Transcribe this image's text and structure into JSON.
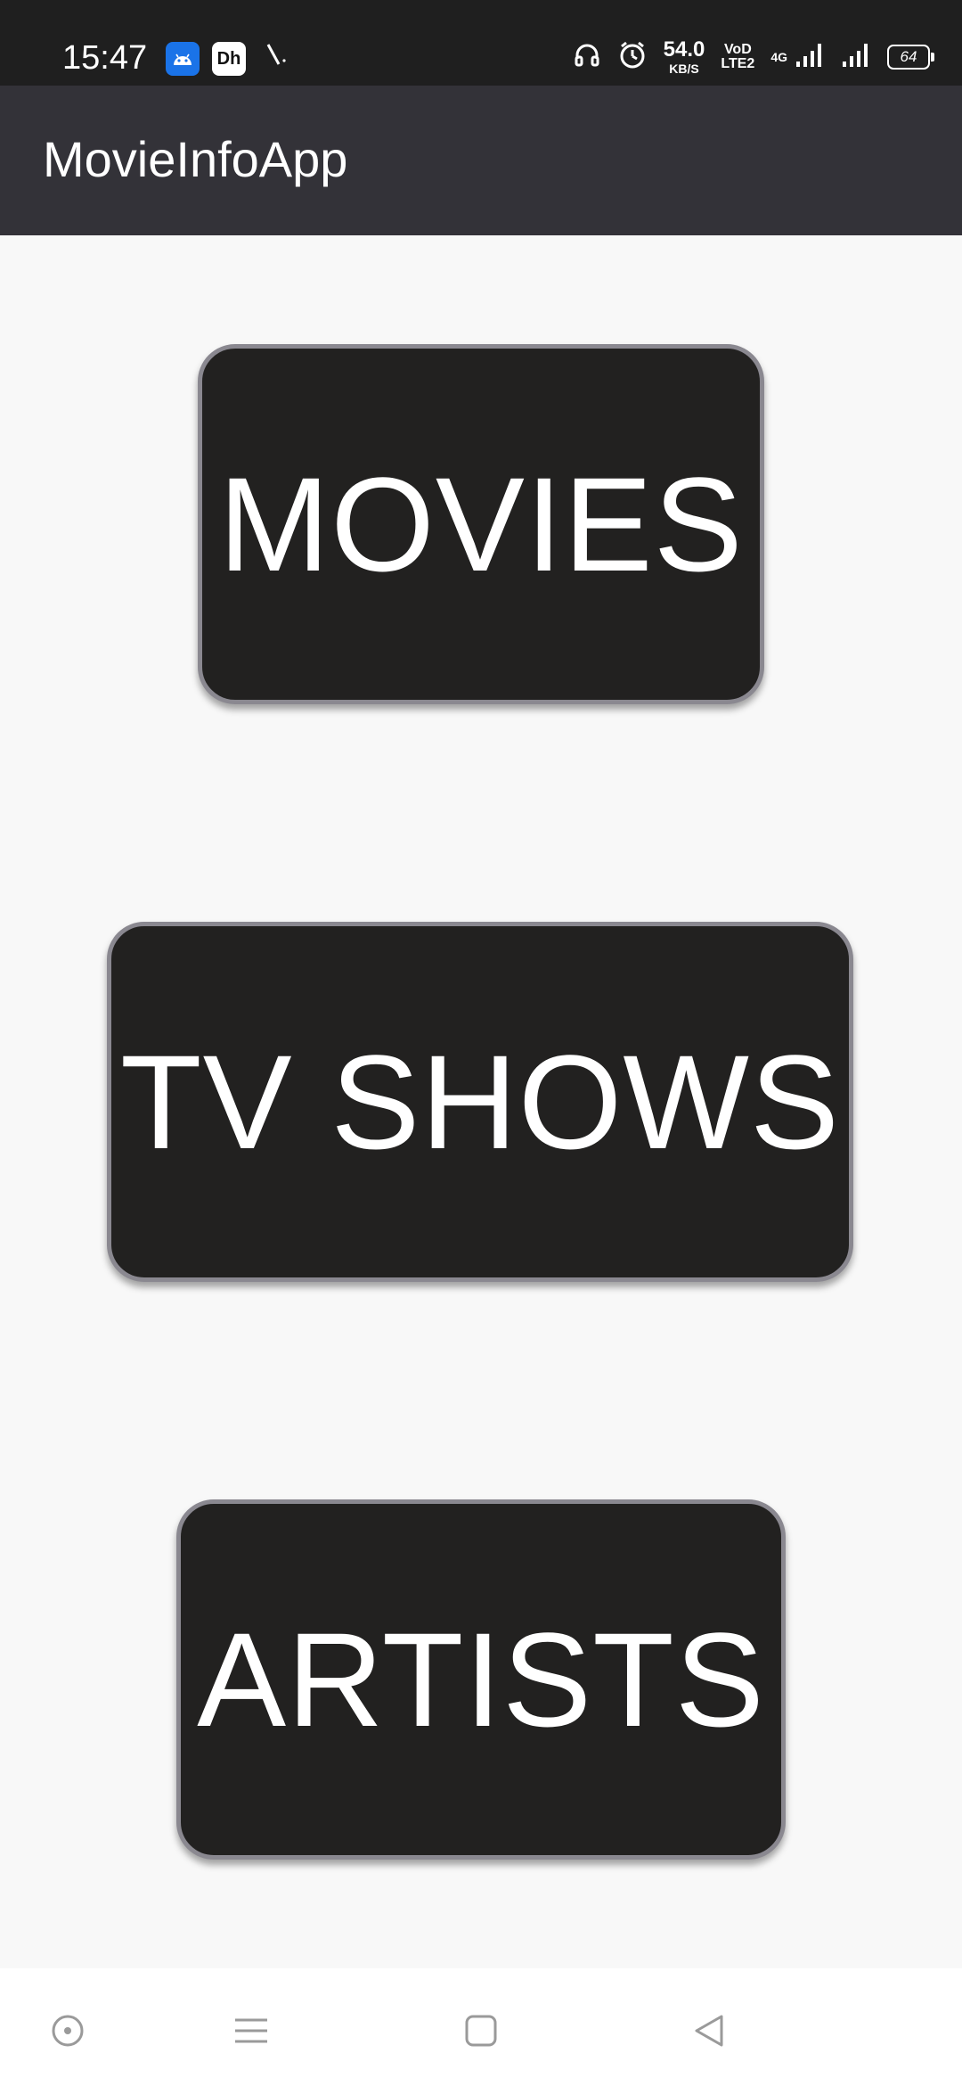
{
  "status_bar": {
    "time": "15:47",
    "icons_left": [
      "android-app-icon",
      "disney-hotstar-icon",
      "slash-icon"
    ],
    "disney_label": "Dh",
    "net_speed_value": "54.0",
    "net_speed_unit": "KB/S",
    "volte_top": "VoD",
    "volte_bottom": "LTE2",
    "network_type": "4G",
    "battery_level": "64",
    "icons_right": [
      "headphones-icon",
      "alarm-icon",
      "signal-icon",
      "signal-icon",
      "battery-icon"
    ]
  },
  "app_bar": {
    "title": "MovieInfoApp",
    "background": "#333238"
  },
  "main": {
    "buttons": [
      {
        "label": "MOVIES"
      },
      {
        "label": "TV SHOWS"
      },
      {
        "label": "ARTISTS"
      }
    ],
    "button_background": "#222120",
    "button_border": "#8a8890"
  },
  "nav_bar": {
    "icons": [
      "circle-dot-icon",
      "menu-icon",
      "home-square-icon",
      "back-triangle-icon"
    ]
  }
}
